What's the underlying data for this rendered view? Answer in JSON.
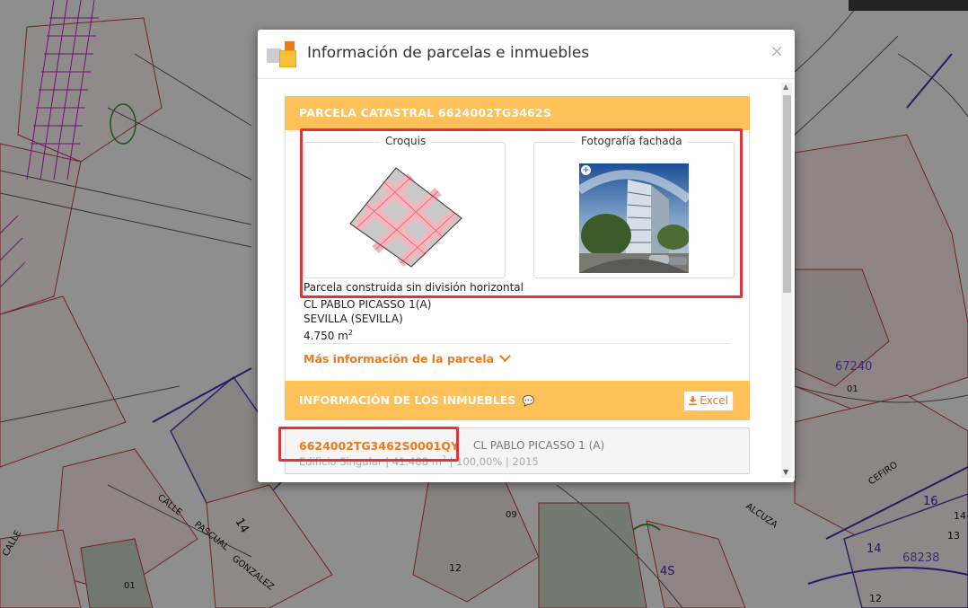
{
  "modal": {
    "title": "Información de parcelas e inmuebles",
    "close_glyph": "×"
  },
  "parcela": {
    "header": "PARCELA CATASTRAL 6624002TG3462S",
    "croquis_label": "Croquis",
    "fachada_label": "Fotografía fachada",
    "description": "Parcela construida sin división horizontal",
    "address_line1": "CL PABLO PICASSO 1(A)",
    "address_line2": "SEVILLA (SEVILLA)",
    "area": "4.750 m",
    "area_unit_sup": "2",
    "more_info": "Más información de la parcela"
  },
  "inmuebles": {
    "header": "INFORMACIÓN DE LOS INMUEBLES",
    "info_glyph": "💬",
    "excel_label": "Excel",
    "rows": [
      {
        "ref": "6624002TG3462S0001QY",
        "address": "CL PABLO PICASSO 1 (A)",
        "use": "Edificio Singular",
        "surface": "41.488 m",
        "surface_sup": "2",
        "participation": "100,00%",
        "year": "2015"
      }
    ]
  },
  "map": {
    "labels": {
      "calle1": "CALLE",
      "pascual": "PASCUAL",
      "gonzalez": "GONZALEZ",
      "calle2": "CALLE",
      "alcuza": "ALCUZA",
      "cefiro": "CEFIRO",
      "n14a": "14",
      "n45": "4S",
      "n16": "16",
      "n14b": "14",
      "n12": "12",
      "n13": "13",
      "n14c": "14",
      "n67240": "67240",
      "n01a": "01",
      "n68238": "68238",
      "n09": "09",
      "n01b": "01",
      "n12b": "12"
    }
  },
  "colors": {
    "accent_orange": "#f07a1a",
    "panel_yellow": "#fec058",
    "highlight_red": "#d9383a"
  }
}
